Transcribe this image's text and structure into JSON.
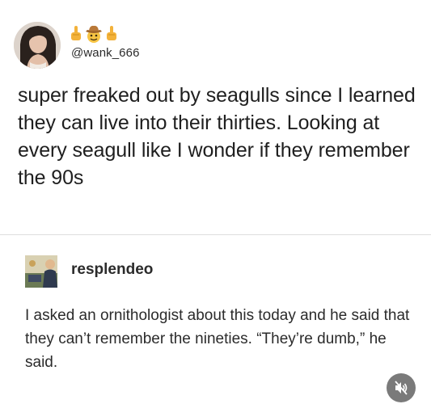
{
  "post": {
    "handle": "@wank_666",
    "text": "super freaked out by seagulls since I learned they can live into their thirties. Looking at every seagull like I wonder if they remember the 90s",
    "emojis": [
      "middle-finger-emoji",
      "cowboy-emoji",
      "middle-finger-emoji"
    ]
  },
  "reply": {
    "username": "resplendeo",
    "text": "I asked an ornithologist about this today and he said that they can’t remember the nineties. “They’re dumb,” he said."
  },
  "video": {
    "muted": true,
    "icon": "speaker-muted-icon"
  }
}
